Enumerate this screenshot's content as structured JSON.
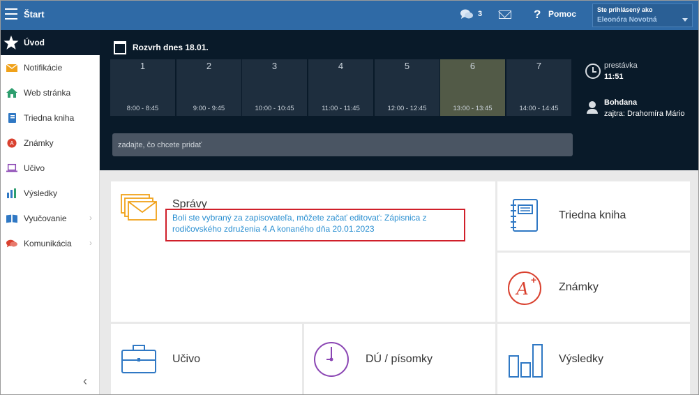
{
  "topbar": {
    "title": "Štart",
    "message_count": "3",
    "help_label": "Pomoc",
    "login_label": "Ste prihlásený ako",
    "user_name": "Eleonóra Novotná"
  },
  "sidebar": {
    "items": [
      {
        "label": "Úvod",
        "icon": "star-icon",
        "color": "#ffffff"
      },
      {
        "label": "Notifikácie",
        "icon": "envelope-icon",
        "color": "#f0a21a"
      },
      {
        "label": "Web stránka",
        "icon": "home-icon",
        "color": "#2e9e6f"
      },
      {
        "label": "Triedna kniha",
        "icon": "notebook-icon",
        "color": "#2f78c4"
      },
      {
        "label": "Známky",
        "icon": "grade-icon",
        "color": "#d9412f"
      },
      {
        "label": "Učivo",
        "icon": "laptop-icon",
        "color": "#8a45b3"
      },
      {
        "label": "Výsledky",
        "icon": "bar-chart-icon",
        "color": "#2f78c4"
      },
      {
        "label": "Vyučovanie",
        "icon": "book-icon",
        "color": "#2f78c4"
      },
      {
        "label": "Komunikácia",
        "icon": "chat-icon",
        "color": "#d9412f"
      }
    ]
  },
  "schedule": {
    "title": "Rozvrh dnes 18.01.",
    "lessons": [
      {
        "num": "1",
        "time": "8:00 - 8:45"
      },
      {
        "num": "2",
        "time": "9:00 - 9:45"
      },
      {
        "num": "3",
        "time": "10:00 - 10:45"
      },
      {
        "num": "4",
        "time": "11:00 - 11:45"
      },
      {
        "num": "5",
        "time": "12:00 - 12:45"
      },
      {
        "num": "6",
        "time": "13:00 - 13:45"
      },
      {
        "num": "7",
        "time": "14:00 - 14:45"
      }
    ],
    "current_lesson": "6",
    "add_placeholder": "zadajte, čo chcete pridať",
    "break_label": "prestávka",
    "break_time": "11:51",
    "duty_name": "Bohdana",
    "duty_tomorrow": "zajtra: Drahomíra Mário"
  },
  "tiles": {
    "messages_title": "Správy",
    "messages_notice": "Boli ste vybraný za zapisovateľa, môžete začať editovať: Zápisnica z rodičovského združenia 4.A konaného dňa 20.01.2023",
    "class_book": "Triedna kniha",
    "grades": "Známky",
    "curriculum": "Učivo",
    "homework": "DÚ / písomky",
    "results": "Výsledky"
  },
  "colors": {
    "topbar": "#2f6aa6",
    "dark_panel": "#091a29",
    "highlight": "#d01f2a",
    "link": "#2a8fd1"
  }
}
